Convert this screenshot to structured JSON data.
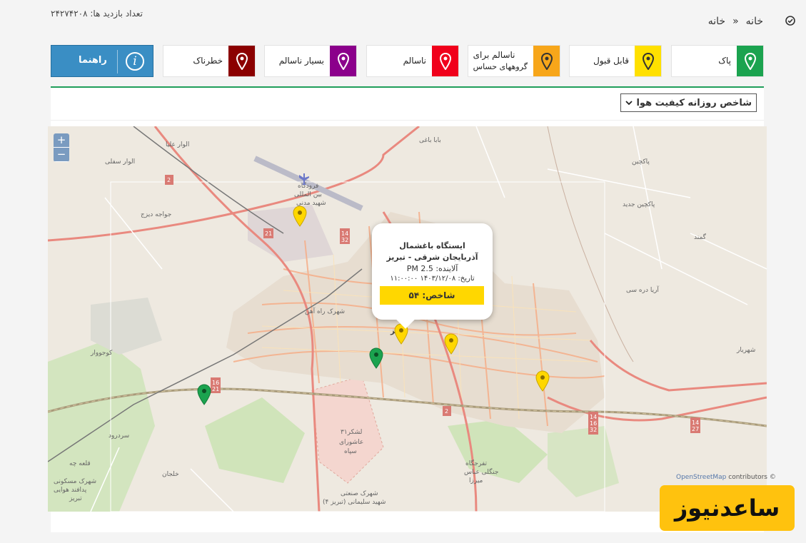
{
  "header": {
    "visits_label": "تعداد بازدید ها:",
    "visits_count": "۲۴۲۷۴۲۰۸",
    "breadcrumb": [
      "خانه",
      "»",
      "خانه"
    ]
  },
  "legend": [
    {
      "label": "پاک",
      "color": "#1ba34f"
    },
    {
      "label": "قابل قبول",
      "color": "#ffe000"
    },
    {
      "label_line1": "ناسالم برای",
      "label_line2": "گروههای حساس",
      "color": "#f7a61a"
    },
    {
      "label": "ناسالم",
      "color": "#f0001b"
    },
    {
      "label": "بسیار ناسالم",
      "color": "#8b008b"
    },
    {
      "label": "خطرناک",
      "color": "#8b0000"
    }
  ],
  "guide_button": {
    "label": "راهنما",
    "icon": "info-icon"
  },
  "selector": {
    "value": "شاخص روزانه کیفیت هوا"
  },
  "map": {
    "zoom_in": "+",
    "zoom_out": "−",
    "attribution_link": "OpenStreetMap",
    "attribution_rest": "contributors ©",
    "popup": {
      "station": "ایستگاه باغشمال",
      "region": "آذربایجان شرقی - تبریز",
      "pollutant": "آلاینده: PM 2.5",
      "date": "تاریخ: ۱۴۰۳/۱۲/۰۸ ۱۱:۰۰:۰۰",
      "index": "شاخص: ۵۴"
    },
    "labels": {
      "kojovar": "کوجووار",
      "sardrud": "سردرود",
      "shahrak": "شهرک راه آهن",
      "shahriar": "شهریار",
      "lashkar1": "لشکر۳۱",
      "lashkar2": "عاشورای",
      "lashkar3": "سپاه",
      "airport1": "فرودگاه",
      "airport2": "بین المللی",
      "airport3": "شهید مدنی",
      "baba": "بابا باغی",
      "pakchin": "پاکچین",
      "jadid": "پاکچین جدید",
      "gomand": "گمند",
      "ariadareh": "آریا دره سی",
      "abbas1": "تفرجگاه",
      "abbas2": "جنگلی عباس",
      "abbas3": "میرزا",
      "hoveyi1": "شهرک مسکونی",
      "hoveyi2": "پدافند هوایی",
      "hoveyi3": "تبریز",
      "sanati1": "شهرک صنعتی",
      "sanati2": "شهید سلیمانی (تبریز ۴)",
      "chehreh": "جواجه دیزج",
      "chele": "قلعه چه",
      "khalajan": "خلجان",
      "alvar": "الوار سفلی",
      "alvar2": "الوار علیا",
      "tabriz": "تبریز"
    }
  },
  "watermark": "ساعدنیوز"
}
